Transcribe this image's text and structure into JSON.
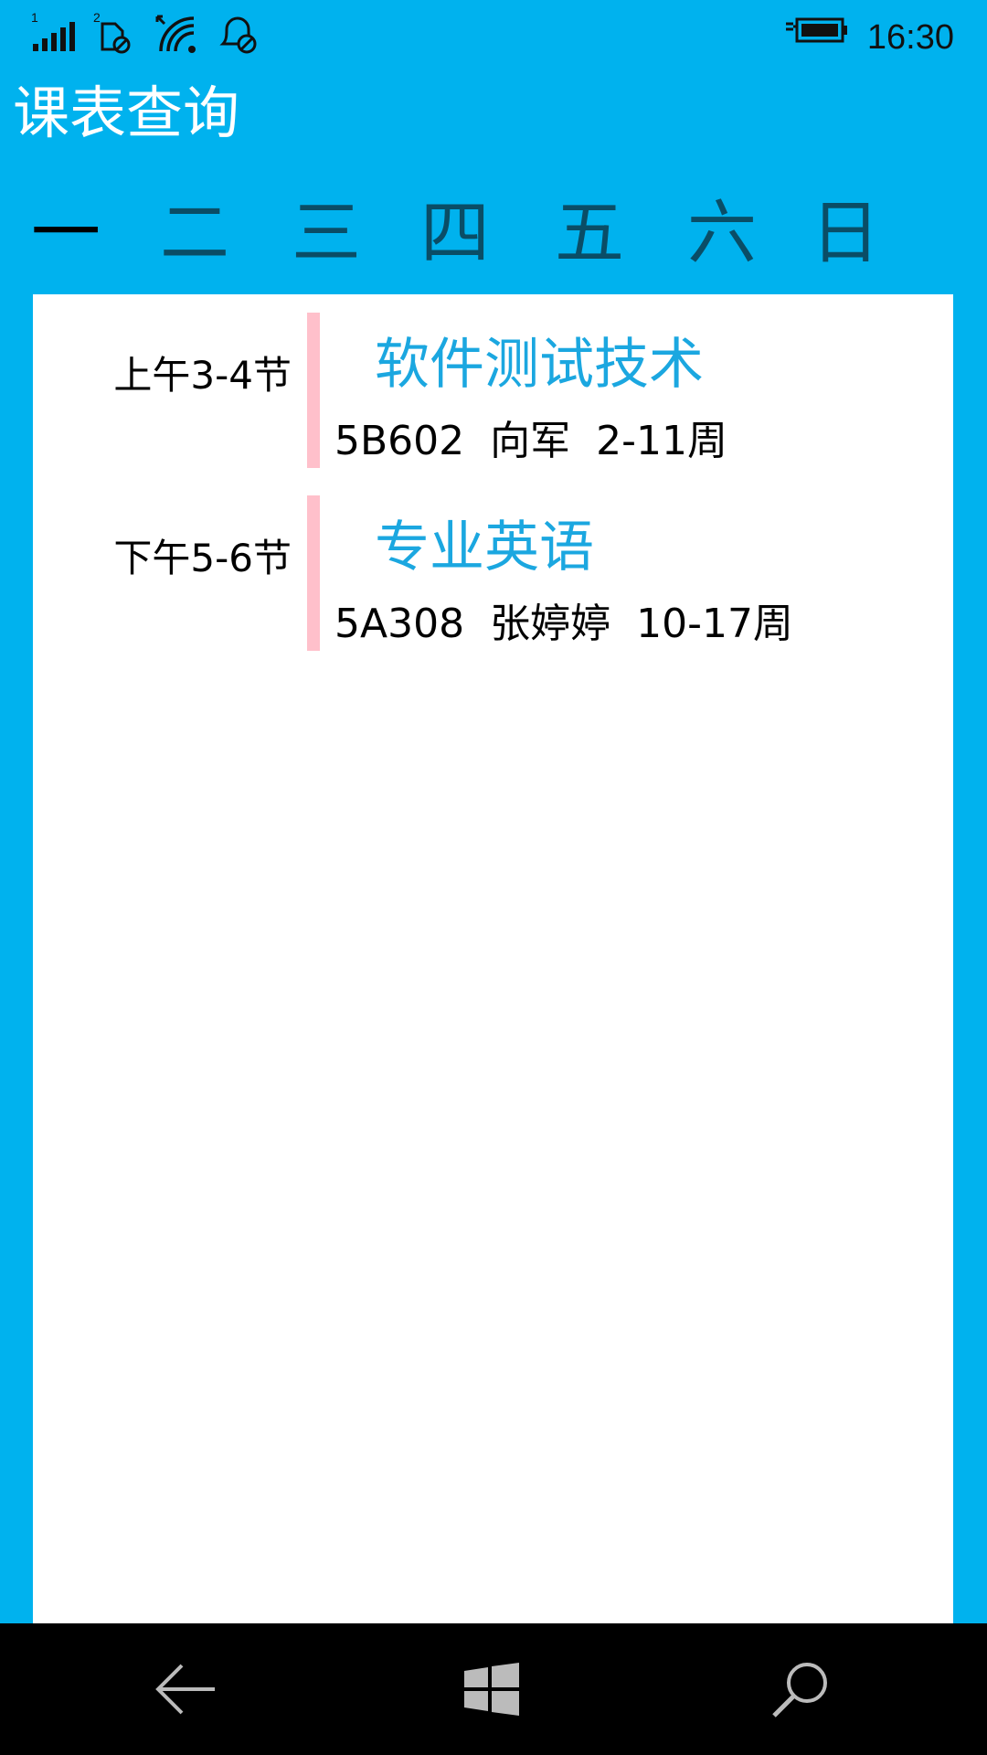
{
  "status_bar": {
    "sim1_label": "1",
    "sim2_label": "2",
    "time": "16:30",
    "icons": [
      "signal-icon",
      "sim2-no-service-icon",
      "wifi-icon",
      "quiet-hours-icon",
      "battery-charging-icon"
    ]
  },
  "app": {
    "title": "课表查询"
  },
  "days": [
    {
      "label": "一",
      "active": true
    },
    {
      "label": "二",
      "active": false
    },
    {
      "label": "三",
      "active": false
    },
    {
      "label": "四",
      "active": false
    },
    {
      "label": "五",
      "active": false
    },
    {
      "label": "六",
      "active": false
    },
    {
      "label": "日",
      "active": false
    }
  ],
  "courses": [
    {
      "period": "上午3-4节",
      "name": "软件测试技术",
      "room": "5B602",
      "teacher": "向军",
      "weeks": "2-11周"
    },
    {
      "period": "下午5-6节",
      "name": "专业英语",
      "room": "5A308",
      "teacher": "张婷婷",
      "weeks": "10-17周"
    }
  ],
  "nav_bar": {
    "icons": [
      "back-arrow-icon",
      "windows-start-icon",
      "search-icon"
    ]
  },
  "colors": {
    "background": "#00B2EE",
    "course_name": "#1BA7E0",
    "accent_bar": "#FFC0CB",
    "inactive_tab": "#0a4d66",
    "active_tab": "#000000"
  }
}
